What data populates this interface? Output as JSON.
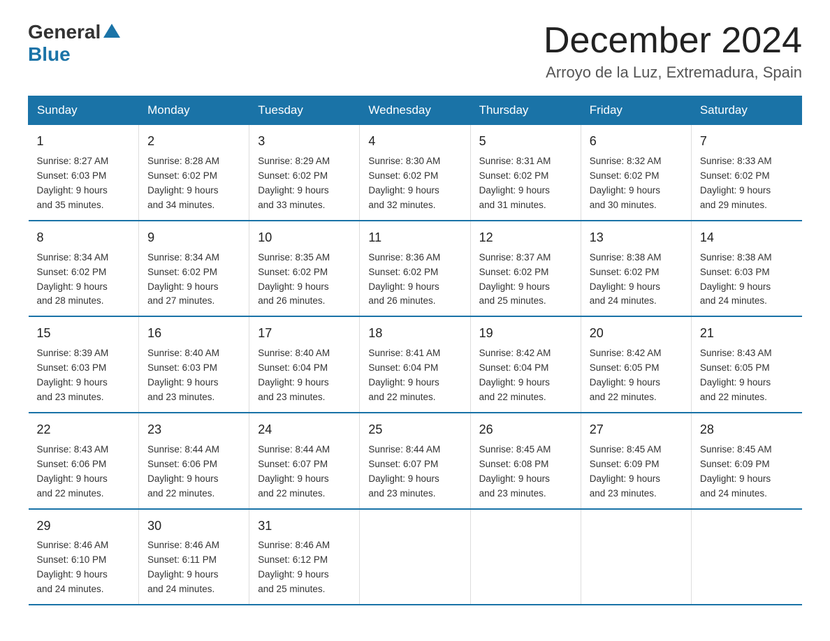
{
  "header": {
    "logo_general": "General",
    "logo_blue": "Blue",
    "month_year": "December 2024",
    "location": "Arroyo de la Luz, Extremadura, Spain"
  },
  "weekdays": [
    "Sunday",
    "Monday",
    "Tuesday",
    "Wednesday",
    "Thursday",
    "Friday",
    "Saturday"
  ],
  "weeks": [
    [
      {
        "day": "1",
        "info": "Sunrise: 8:27 AM\nSunset: 6:03 PM\nDaylight: 9 hours\nand 35 minutes."
      },
      {
        "day": "2",
        "info": "Sunrise: 8:28 AM\nSunset: 6:02 PM\nDaylight: 9 hours\nand 34 minutes."
      },
      {
        "day": "3",
        "info": "Sunrise: 8:29 AM\nSunset: 6:02 PM\nDaylight: 9 hours\nand 33 minutes."
      },
      {
        "day": "4",
        "info": "Sunrise: 8:30 AM\nSunset: 6:02 PM\nDaylight: 9 hours\nand 32 minutes."
      },
      {
        "day": "5",
        "info": "Sunrise: 8:31 AM\nSunset: 6:02 PM\nDaylight: 9 hours\nand 31 minutes."
      },
      {
        "day": "6",
        "info": "Sunrise: 8:32 AM\nSunset: 6:02 PM\nDaylight: 9 hours\nand 30 minutes."
      },
      {
        "day": "7",
        "info": "Sunrise: 8:33 AM\nSunset: 6:02 PM\nDaylight: 9 hours\nand 29 minutes."
      }
    ],
    [
      {
        "day": "8",
        "info": "Sunrise: 8:34 AM\nSunset: 6:02 PM\nDaylight: 9 hours\nand 28 minutes."
      },
      {
        "day": "9",
        "info": "Sunrise: 8:34 AM\nSunset: 6:02 PM\nDaylight: 9 hours\nand 27 minutes."
      },
      {
        "day": "10",
        "info": "Sunrise: 8:35 AM\nSunset: 6:02 PM\nDaylight: 9 hours\nand 26 minutes."
      },
      {
        "day": "11",
        "info": "Sunrise: 8:36 AM\nSunset: 6:02 PM\nDaylight: 9 hours\nand 26 minutes."
      },
      {
        "day": "12",
        "info": "Sunrise: 8:37 AM\nSunset: 6:02 PM\nDaylight: 9 hours\nand 25 minutes."
      },
      {
        "day": "13",
        "info": "Sunrise: 8:38 AM\nSunset: 6:02 PM\nDaylight: 9 hours\nand 24 minutes."
      },
      {
        "day": "14",
        "info": "Sunrise: 8:38 AM\nSunset: 6:03 PM\nDaylight: 9 hours\nand 24 minutes."
      }
    ],
    [
      {
        "day": "15",
        "info": "Sunrise: 8:39 AM\nSunset: 6:03 PM\nDaylight: 9 hours\nand 23 minutes."
      },
      {
        "day": "16",
        "info": "Sunrise: 8:40 AM\nSunset: 6:03 PM\nDaylight: 9 hours\nand 23 minutes."
      },
      {
        "day": "17",
        "info": "Sunrise: 8:40 AM\nSunset: 6:04 PM\nDaylight: 9 hours\nand 23 minutes."
      },
      {
        "day": "18",
        "info": "Sunrise: 8:41 AM\nSunset: 6:04 PM\nDaylight: 9 hours\nand 22 minutes."
      },
      {
        "day": "19",
        "info": "Sunrise: 8:42 AM\nSunset: 6:04 PM\nDaylight: 9 hours\nand 22 minutes."
      },
      {
        "day": "20",
        "info": "Sunrise: 8:42 AM\nSunset: 6:05 PM\nDaylight: 9 hours\nand 22 minutes."
      },
      {
        "day": "21",
        "info": "Sunrise: 8:43 AM\nSunset: 6:05 PM\nDaylight: 9 hours\nand 22 minutes."
      }
    ],
    [
      {
        "day": "22",
        "info": "Sunrise: 8:43 AM\nSunset: 6:06 PM\nDaylight: 9 hours\nand 22 minutes."
      },
      {
        "day": "23",
        "info": "Sunrise: 8:44 AM\nSunset: 6:06 PM\nDaylight: 9 hours\nand 22 minutes."
      },
      {
        "day": "24",
        "info": "Sunrise: 8:44 AM\nSunset: 6:07 PM\nDaylight: 9 hours\nand 22 minutes."
      },
      {
        "day": "25",
        "info": "Sunrise: 8:44 AM\nSunset: 6:07 PM\nDaylight: 9 hours\nand 23 minutes."
      },
      {
        "day": "26",
        "info": "Sunrise: 8:45 AM\nSunset: 6:08 PM\nDaylight: 9 hours\nand 23 minutes."
      },
      {
        "day": "27",
        "info": "Sunrise: 8:45 AM\nSunset: 6:09 PM\nDaylight: 9 hours\nand 23 minutes."
      },
      {
        "day": "28",
        "info": "Sunrise: 8:45 AM\nSunset: 6:09 PM\nDaylight: 9 hours\nand 24 minutes."
      }
    ],
    [
      {
        "day": "29",
        "info": "Sunrise: 8:46 AM\nSunset: 6:10 PM\nDaylight: 9 hours\nand 24 minutes."
      },
      {
        "day": "30",
        "info": "Sunrise: 8:46 AM\nSunset: 6:11 PM\nDaylight: 9 hours\nand 24 minutes."
      },
      {
        "day": "31",
        "info": "Sunrise: 8:46 AM\nSunset: 6:12 PM\nDaylight: 9 hours\nand 25 minutes."
      },
      {
        "day": "",
        "info": ""
      },
      {
        "day": "",
        "info": ""
      },
      {
        "day": "",
        "info": ""
      },
      {
        "day": "",
        "info": ""
      }
    ]
  ]
}
